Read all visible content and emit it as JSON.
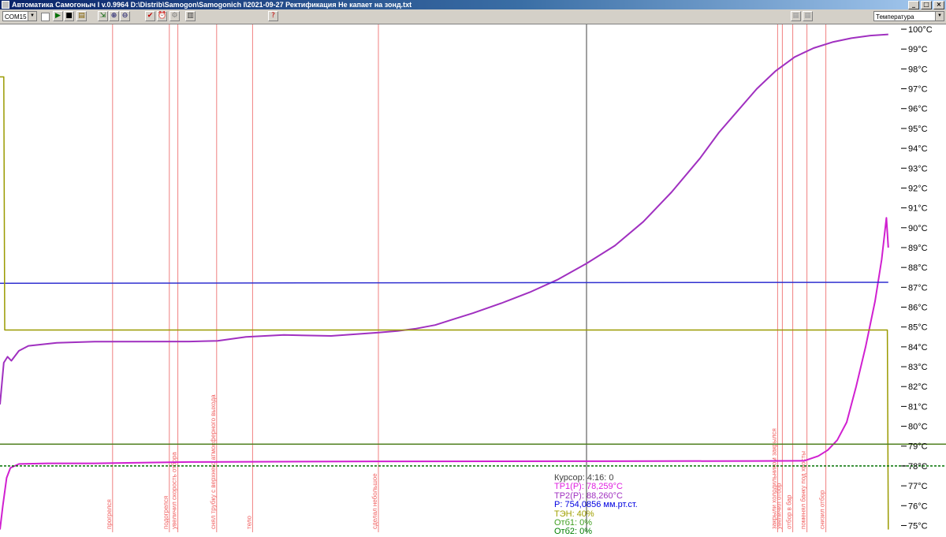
{
  "window": {
    "title": "Автоматика Самогоныч I v.0.9964 D:\\Distrib\\Samogon\\Samogonich I\\2021-09-27 Ректификация Не капает на зонд.txt"
  },
  "toolbar": {
    "port": "COM15",
    "view_mode": "Температура",
    "buttons": [
      {
        "name": "play-button",
        "icon": "play-icon",
        "glyph": "▶",
        "color": "#007000"
      },
      {
        "name": "stop-button",
        "icon": "stop-icon",
        "glyph": "■",
        "color": "#000000"
      },
      {
        "name": "open-file-button",
        "icon": "file-icon",
        "glyph": "▤",
        "color": "#806000"
      },
      {
        "name": "fit-view-button",
        "icon": "fit-icon",
        "glyph": "⇲",
        "color": "#006000"
      },
      {
        "name": "zoom-in-button",
        "icon": "zoom-in-icon",
        "glyph": "⊕",
        "color": "#000060"
      },
      {
        "name": "zoom-out-button",
        "icon": "zoom-out-icon",
        "glyph": "⊖",
        "color": "#000060"
      },
      {
        "name": "mark-button",
        "icon": "checkmark-icon",
        "glyph": "✔",
        "color": "#c00000"
      },
      {
        "name": "alarm-button",
        "icon": "alarm-clock-icon",
        "glyph": "⏰",
        "color": "#a00000"
      },
      {
        "name": "settings-button",
        "icon": "gear-icon",
        "glyph": "⚙",
        "color": "#808080"
      },
      {
        "name": "columns-button",
        "icon": "columns-icon",
        "glyph": "▥",
        "color": "#404040"
      },
      {
        "name": "help-button",
        "icon": "help-icon",
        "glyph": "?",
        "color": "#c00000"
      },
      {
        "name": "extra-button-1",
        "icon": "disabled-icon",
        "glyph": "▦",
        "color": "#a0a0a0"
      },
      {
        "name": "extra-button-2",
        "icon": "disabled-icon",
        "glyph": "▦",
        "color": "#a0a0a0"
      }
    ]
  },
  "chart_data": {
    "type": "line",
    "y_unit": "°C",
    "yticks": [
      "100°C",
      "99°C",
      "98°C",
      "97°C",
      "96°C",
      "95°C",
      "94°C",
      "93°C",
      "92°C",
      "91°C",
      "90°C",
      "89°C",
      "88°C",
      "87°C",
      "86°C",
      "85°C",
      "84°C",
      "83°C",
      "82°C",
      "81°C",
      "80°C",
      "79°C",
      "78°C",
      "77°C",
      "76°C",
      "75°C"
    ],
    "ylim": [
      74.7,
      100.2
    ],
    "x_fraction_range": [
      0,
      1
    ],
    "cursor_x_fraction": 0.62,
    "markers": [
      {
        "x": 0.119,
        "label": "прогрелся"
      },
      {
        "x": 0.179,
        "label": "подогрелся"
      },
      {
        "x": 0.188,
        "label": "увеличил скорость отбора"
      },
      {
        "x": 0.229,
        "label": "снял трубку с верхнего атмосферного выхода"
      },
      {
        "x": 0.267,
        "label": "тело"
      },
      {
        "x": 0.4,
        "label": "сделал небольшое"
      },
      {
        "x": 0.822,
        "label": "закрыли холодильником закрылся"
      },
      {
        "x": 0.827,
        "label": "увеличил отбор"
      },
      {
        "x": 0.838,
        "label": "отбор в бар"
      },
      {
        "x": 0.853,
        "label": "поменял банку под хвосты"
      },
      {
        "x": 0.873,
        "label": "снизил отбор"
      }
    ],
    "series": [
      {
        "name": "ТР1(Р)",
        "color": "#d020d0",
        "points": [
          [
            0.0,
            74.8
          ],
          [
            0.003,
            76.0
          ],
          [
            0.007,
            77.4
          ],
          [
            0.011,
            77.9
          ],
          [
            0.02,
            78.1
          ],
          [
            0.05,
            78.13
          ],
          [
            0.1,
            78.13
          ],
          [
            0.2,
            78.2
          ],
          [
            0.4,
            78.23
          ],
          [
            0.6,
            78.24
          ],
          [
            0.8,
            78.25
          ],
          [
            0.85,
            78.26
          ],
          [
            0.865,
            78.5
          ],
          [
            0.875,
            78.8
          ],
          [
            0.885,
            79.3
          ],
          [
            0.895,
            80.2
          ],
          [
            0.905,
            82.0
          ],
          [
            0.915,
            84.0
          ],
          [
            0.925,
            86.3
          ],
          [
            0.932,
            88.4
          ],
          [
            0.937,
            90.5
          ],
          [
            0.939,
            89.0
          ]
        ]
      },
      {
        "name": "ТР2(Р)",
        "color": "#a030c0",
        "points": [
          [
            0.0,
            81.1
          ],
          [
            0.004,
            83.2
          ],
          [
            0.008,
            83.5
          ],
          [
            0.012,
            83.3
          ],
          [
            0.02,
            83.8
          ],
          [
            0.03,
            84.05
          ],
          [
            0.06,
            84.2
          ],
          [
            0.1,
            84.26
          ],
          [
            0.2,
            84.27
          ],
          [
            0.23,
            84.3
          ],
          [
            0.26,
            84.5
          ],
          [
            0.3,
            84.6
          ],
          [
            0.35,
            84.55
          ],
          [
            0.4,
            84.72
          ],
          [
            0.42,
            84.8
          ],
          [
            0.44,
            84.92
          ],
          [
            0.46,
            85.1
          ],
          [
            0.48,
            85.4
          ],
          [
            0.5,
            85.7
          ],
          [
            0.53,
            86.2
          ],
          [
            0.56,
            86.75
          ],
          [
            0.59,
            87.4
          ],
          [
            0.62,
            88.2
          ],
          [
            0.65,
            89.1
          ],
          [
            0.68,
            90.3
          ],
          [
            0.71,
            91.8
          ],
          [
            0.74,
            93.5
          ],
          [
            0.76,
            94.8
          ],
          [
            0.78,
            95.9
          ],
          [
            0.8,
            97.0
          ],
          [
            0.82,
            97.9
          ],
          [
            0.84,
            98.6
          ],
          [
            0.86,
            99.05
          ],
          [
            0.88,
            99.35
          ],
          [
            0.9,
            99.55
          ],
          [
            0.92,
            99.68
          ],
          [
            0.939,
            99.74
          ]
        ]
      },
      {
        "name": "P",
        "color": "#3030d0",
        "points": [
          [
            0.0,
            87.2
          ],
          [
            0.5,
            87.23
          ],
          [
            0.939,
            87.25
          ]
        ]
      },
      {
        "name": "ТЭН",
        "color": "#9a9a00",
        "points": [
          [
            0.0,
            97.6
          ],
          [
            0.004,
            97.6
          ],
          [
            0.005,
            84.85
          ],
          [
            0.938,
            84.85
          ],
          [
            0.939,
            74.8
          ]
        ]
      },
      {
        "name": "Отб1",
        "color": "#508020",
        "points": [
          [
            0.0,
            79.1
          ],
          [
            1.0,
            79.1
          ]
        ]
      },
      {
        "name": "Отб2",
        "color": "#007000",
        "dashed": true,
        "points": [
          [
            0.0,
            78.0
          ],
          [
            1.0,
            78.0
          ]
        ]
      }
    ]
  },
  "readout": {
    "cursor": {
      "text": "Курсор:  4:16: 0",
      "color": "#404040"
    },
    "tp1": {
      "text": "ТР1(Р): 78,259°C",
      "color": "#e020e0"
    },
    "tp2": {
      "text": "ТР2(Р): 88,260°C",
      "color": "#a030c0"
    },
    "pressure": {
      "text": "P: 754,0856 мм.рт.ст.",
      "color": "#0000e0"
    },
    "heater": {
      "text": "ТЭН: 40%",
      "color": "#a0a000"
    },
    "otb1": {
      "text": "Отб1: 0%",
      "color": "#40a020"
    },
    "otb2": {
      "text": "Отб2: 0%",
      "color": "#008000"
    }
  }
}
